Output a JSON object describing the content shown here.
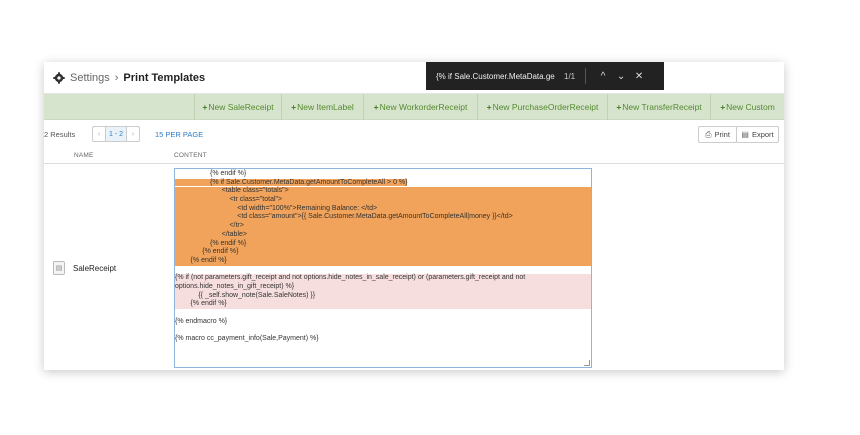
{
  "breadcrumb": {
    "root": "Settings",
    "separator": "›",
    "current": "Print Templates"
  },
  "find_bar": {
    "query": "{% if Sale.Customer.MetaData.ge",
    "count": "1/1"
  },
  "actions": [
    {
      "label": "New SaleReceipt"
    },
    {
      "label": "New ItemLabel"
    },
    {
      "label": "New WorkorderReceipt"
    },
    {
      "label": "New PurchaseOrderReceipt"
    },
    {
      "label": "New TransferReceipt"
    },
    {
      "label": "New Custom"
    }
  ],
  "toolbar": {
    "results": "2 Results",
    "page_range": "1 - 2",
    "per_page": "15 PER PAGE",
    "print_label": "Print",
    "export_label": "Export"
  },
  "columns": {
    "name": "NAME",
    "content": "CONTENT"
  },
  "row": {
    "name": "SaleReceipt"
  },
  "editor_lines": [
    {
      "text": "                  {% endif %}",
      "style": "partial-hl"
    },
    {
      "text": "                  {% if Sale.Customer.MetaData.getAmountToCompleteAll > 0 %}",
      "style": "partial-hl"
    },
    {
      "text": "                        <table class=\"totals\">",
      "style": "hl"
    },
    {
      "text": "                            <tr class=\"total\">",
      "style": "hl"
    },
    {
      "text": "                                <td width=\"100%\">Remaining Balance: </td>",
      "style": "hl"
    },
    {
      "text": "                                <td class=\"amount\">{{ Sale.Customer.MetaData.getAmountToCompleteAll|money }}</td>",
      "style": "hl"
    },
    {
      "text": "                            </tr>",
      "style": "hl"
    },
    {
      "text": "                        </table>",
      "style": "hl"
    },
    {
      "text": "                  {% endif %}",
      "style": "hl"
    },
    {
      "text": "              {% endif %}",
      "style": "hl"
    },
    {
      "text": "        {% endif %}",
      "style": "hl"
    },
    {
      "text": "",
      "style": "plain"
    },
    {
      "text": "{% if (not parameters.gift_receipt and not options.hide_notes_in_sale_receipt) or (parameters.gift_receipt and not",
      "style": "pk"
    },
    {
      "text": "options.hide_notes_in_gift_receipt) %}",
      "style": "pk"
    },
    {
      "text": "            {{ _self.show_note(Sale.SaleNotes) }}",
      "style": "pk"
    },
    {
      "text": "        {% endif %}",
      "style": "pk"
    },
    {
      "text": "",
      "style": "plain"
    },
    {
      "text": "{% endmacro %}",
      "style": "plain"
    },
    {
      "text": "",
      "style": "plain"
    },
    {
      "text": "{% macro cc_payment_info(Sale,Payment) %}",
      "style": "plain"
    }
  ],
  "icons": {
    "settings": "gear-icon",
    "find_up": "chevron-up-icon",
    "find_down": "chevron-down-icon",
    "find_close": "close-icon",
    "print": "printer-icon",
    "export": "document-icon",
    "row": "document-icon"
  },
  "colors": {
    "accent_green": "#558a2f",
    "action_bar": "#d6e4cd",
    "highlight": "#f1a35b",
    "link_blue": "#2d7bc4"
  }
}
